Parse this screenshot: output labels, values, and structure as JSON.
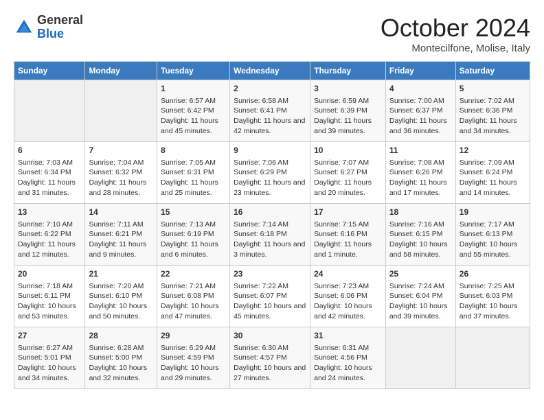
{
  "header": {
    "logo_general": "General",
    "logo_blue": "Blue",
    "month": "October 2024",
    "location": "Montecilfone, Molise, Italy"
  },
  "weekdays": [
    "Sunday",
    "Monday",
    "Tuesday",
    "Wednesday",
    "Thursday",
    "Friday",
    "Saturday"
  ],
  "weeks": [
    [
      {
        "day": "",
        "sunrise": "",
        "sunset": "",
        "daylight": ""
      },
      {
        "day": "",
        "sunrise": "",
        "sunset": "",
        "daylight": ""
      },
      {
        "day": "1",
        "sunrise": "Sunrise: 6:57 AM",
        "sunset": "Sunset: 6:42 PM",
        "daylight": "Daylight: 11 hours and 45 minutes."
      },
      {
        "day": "2",
        "sunrise": "Sunrise: 6:58 AM",
        "sunset": "Sunset: 6:41 PM",
        "daylight": "Daylight: 11 hours and 42 minutes."
      },
      {
        "day": "3",
        "sunrise": "Sunrise: 6:59 AM",
        "sunset": "Sunset: 6:39 PM",
        "daylight": "Daylight: 11 hours and 39 minutes."
      },
      {
        "day": "4",
        "sunrise": "Sunrise: 7:00 AM",
        "sunset": "Sunset: 6:37 PM",
        "daylight": "Daylight: 11 hours and 36 minutes."
      },
      {
        "day": "5",
        "sunrise": "Sunrise: 7:02 AM",
        "sunset": "Sunset: 6:36 PM",
        "daylight": "Daylight: 11 hours and 34 minutes."
      }
    ],
    [
      {
        "day": "6",
        "sunrise": "Sunrise: 7:03 AM",
        "sunset": "Sunset: 6:34 PM",
        "daylight": "Daylight: 11 hours and 31 minutes."
      },
      {
        "day": "7",
        "sunrise": "Sunrise: 7:04 AM",
        "sunset": "Sunset: 6:32 PM",
        "daylight": "Daylight: 11 hours and 28 minutes."
      },
      {
        "day": "8",
        "sunrise": "Sunrise: 7:05 AM",
        "sunset": "Sunset: 6:31 PM",
        "daylight": "Daylight: 11 hours and 25 minutes."
      },
      {
        "day": "9",
        "sunrise": "Sunrise: 7:06 AM",
        "sunset": "Sunset: 6:29 PM",
        "daylight": "Daylight: 11 hours and 23 minutes."
      },
      {
        "day": "10",
        "sunrise": "Sunrise: 7:07 AM",
        "sunset": "Sunset: 6:27 PM",
        "daylight": "Daylight: 11 hours and 20 minutes."
      },
      {
        "day": "11",
        "sunrise": "Sunrise: 7:08 AM",
        "sunset": "Sunset: 6:26 PM",
        "daylight": "Daylight: 11 hours and 17 minutes."
      },
      {
        "day": "12",
        "sunrise": "Sunrise: 7:09 AM",
        "sunset": "Sunset: 6:24 PM",
        "daylight": "Daylight: 11 hours and 14 minutes."
      }
    ],
    [
      {
        "day": "13",
        "sunrise": "Sunrise: 7:10 AM",
        "sunset": "Sunset: 6:22 PM",
        "daylight": "Daylight: 11 hours and 12 minutes."
      },
      {
        "day": "14",
        "sunrise": "Sunrise: 7:11 AM",
        "sunset": "Sunset: 6:21 PM",
        "daylight": "Daylight: 11 hours and 9 minutes."
      },
      {
        "day": "15",
        "sunrise": "Sunrise: 7:13 AM",
        "sunset": "Sunset: 6:19 PM",
        "daylight": "Daylight: 11 hours and 6 minutes."
      },
      {
        "day": "16",
        "sunrise": "Sunrise: 7:14 AM",
        "sunset": "Sunset: 6:18 PM",
        "daylight": "Daylight: 11 hours and 3 minutes."
      },
      {
        "day": "17",
        "sunrise": "Sunrise: 7:15 AM",
        "sunset": "Sunset: 6:16 PM",
        "daylight": "Daylight: 11 hours and 1 minute."
      },
      {
        "day": "18",
        "sunrise": "Sunrise: 7:16 AM",
        "sunset": "Sunset: 6:15 PM",
        "daylight": "Daylight: 10 hours and 58 minutes."
      },
      {
        "day": "19",
        "sunrise": "Sunrise: 7:17 AM",
        "sunset": "Sunset: 6:13 PM",
        "daylight": "Daylight: 10 hours and 55 minutes."
      }
    ],
    [
      {
        "day": "20",
        "sunrise": "Sunrise: 7:18 AM",
        "sunset": "Sunset: 6:11 PM",
        "daylight": "Daylight: 10 hours and 53 minutes."
      },
      {
        "day": "21",
        "sunrise": "Sunrise: 7:20 AM",
        "sunset": "Sunset: 6:10 PM",
        "daylight": "Daylight: 10 hours and 50 minutes."
      },
      {
        "day": "22",
        "sunrise": "Sunrise: 7:21 AM",
        "sunset": "Sunset: 6:08 PM",
        "daylight": "Daylight: 10 hours and 47 minutes."
      },
      {
        "day": "23",
        "sunrise": "Sunrise: 7:22 AM",
        "sunset": "Sunset: 6:07 PM",
        "daylight": "Daylight: 10 hours and 45 minutes."
      },
      {
        "day": "24",
        "sunrise": "Sunrise: 7:23 AM",
        "sunset": "Sunset: 6:06 PM",
        "daylight": "Daylight: 10 hours and 42 minutes."
      },
      {
        "day": "25",
        "sunrise": "Sunrise: 7:24 AM",
        "sunset": "Sunset: 6:04 PM",
        "daylight": "Daylight: 10 hours and 39 minutes."
      },
      {
        "day": "26",
        "sunrise": "Sunrise: 7:25 AM",
        "sunset": "Sunset: 6:03 PM",
        "daylight": "Daylight: 10 hours and 37 minutes."
      }
    ],
    [
      {
        "day": "27",
        "sunrise": "Sunrise: 6:27 AM",
        "sunset": "Sunset: 5:01 PM",
        "daylight": "Daylight: 10 hours and 34 minutes."
      },
      {
        "day": "28",
        "sunrise": "Sunrise: 6:28 AM",
        "sunset": "Sunset: 5:00 PM",
        "daylight": "Daylight: 10 hours and 32 minutes."
      },
      {
        "day": "29",
        "sunrise": "Sunrise: 6:29 AM",
        "sunset": "Sunset: 4:59 PM",
        "daylight": "Daylight: 10 hours and 29 minutes."
      },
      {
        "day": "30",
        "sunrise": "Sunrise: 6:30 AM",
        "sunset": "Sunset: 4:57 PM",
        "daylight": "Daylight: 10 hours and 27 minutes."
      },
      {
        "day": "31",
        "sunrise": "Sunrise: 6:31 AM",
        "sunset": "Sunset: 4:56 PM",
        "daylight": "Daylight: 10 hours and 24 minutes."
      },
      {
        "day": "",
        "sunrise": "",
        "sunset": "",
        "daylight": ""
      },
      {
        "day": "",
        "sunrise": "",
        "sunset": "",
        "daylight": ""
      }
    ]
  ]
}
